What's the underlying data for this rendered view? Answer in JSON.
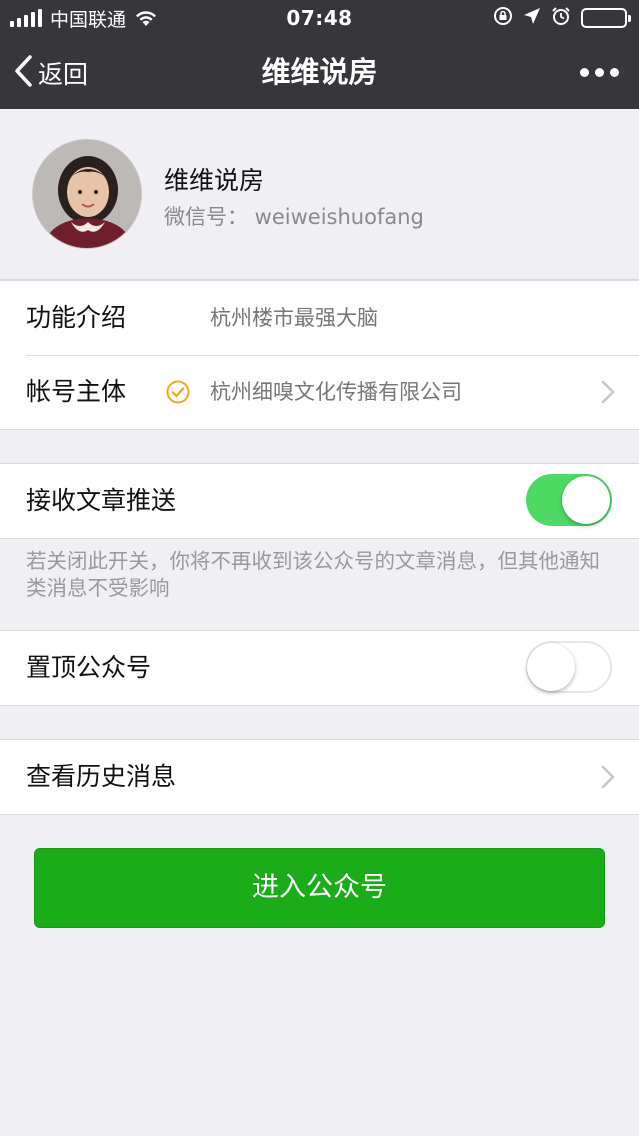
{
  "status_bar": {
    "carrier": "中国联通",
    "time": "07:48"
  },
  "nav": {
    "back_label": "返回",
    "title": "维维说房"
  },
  "profile": {
    "name": "维维说房",
    "wechat_id": "微信号：  weiweishuofang"
  },
  "info": {
    "intro_label": "功能介绍",
    "intro_value": "杭州楼市最强大脑",
    "account_label": "帐号主体",
    "account_value": "杭州细嗅文化传播有限公司"
  },
  "settings": {
    "receive_label": "接收文章推送",
    "receive_on": true,
    "hint": "若关闭此开关，你将不再收到该公众号的文章消息，但其他通知类消息不受影响",
    "pin_label": "置顶公众号",
    "pin_on": false
  },
  "history": {
    "label": "查看历史消息"
  },
  "enter_button": "进入公众号",
  "colors": {
    "nav_bg": "#37373b",
    "page_bg": "#efeff4",
    "toggle_on": "#4cd964",
    "primary_button": "#1aad19",
    "verified": "#f5a623"
  }
}
